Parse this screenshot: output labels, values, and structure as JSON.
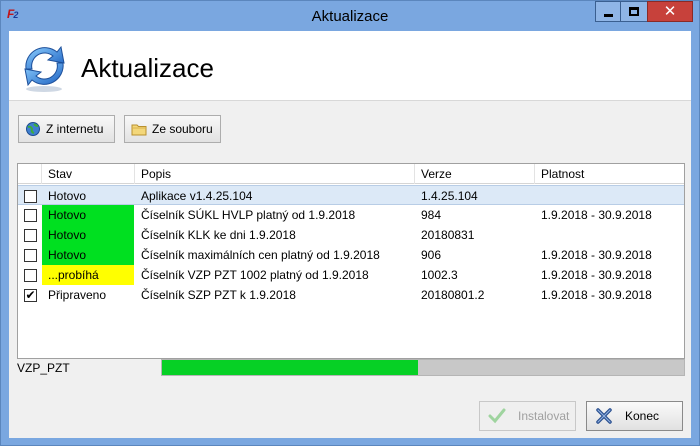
{
  "window": {
    "title": "Aktualizace",
    "app_icon_text": "F",
    "app_icon_sub": "2",
    "icons": {
      "minimize": "minimize-icon",
      "maximize": "maximize-icon",
      "close": "close-icon",
      "close_glyph": "✕"
    }
  },
  "header": {
    "title": "Aktualizace",
    "icon": "refresh-arrows-icon"
  },
  "toolbar": {
    "internet_label": "Z internetu",
    "internet_icon": "globe-icon",
    "soubor_label": "Ze souboru",
    "soubor_icon": "folder-icon"
  },
  "grid": {
    "columns": {
      "stav": "Stav",
      "popis": "Popis",
      "verze": "Verze",
      "platnost": "Platnost"
    },
    "rows": [
      {
        "checked": false,
        "stav": "Hotovo",
        "stav_color": "",
        "popis": "Aplikace v1.4.25.104",
        "verze": "1.4.25.104",
        "platnost": "",
        "selected": true
      },
      {
        "checked": false,
        "stav": "Hotovo",
        "stav_color": "#00e020",
        "popis": "Číselník SÚKL HVLP platný od 1.9.2018",
        "verze": "984",
        "platnost": "1.9.2018 - 30.9.2018",
        "selected": false
      },
      {
        "checked": false,
        "stav": "Hotovo",
        "stav_color": "#00e020",
        "popis": "Číselník KLK ke dni 1.9.2018",
        "verze": "20180831",
        "platnost": "",
        "selected": false
      },
      {
        "checked": false,
        "stav": "Hotovo",
        "stav_color": "#00e020",
        "popis": "Číselník maximálních cen platný od 1.9.2018",
        "verze": "906",
        "platnost": "1.9.2018 - 30.9.2018",
        "selected": false
      },
      {
        "checked": false,
        "stav": "...probíhá",
        "stav_color": "#ffff00",
        "popis": "Číselník VZP PZT 1002 platný od 1.9.2018",
        "verze": "1002.3",
        "platnost": "1.9.2018 - 30.9.2018",
        "selected": false
      },
      {
        "checked": true,
        "stav": "Připraveno",
        "stav_color": "",
        "popis": "Číselník SZP PZT k 1.9.2018",
        "verze": "20180801.2",
        "platnost": "1.9.2018 - 30.9.2018",
        "selected": false
      }
    ],
    "check_glyph": "✔"
  },
  "progress": {
    "label": "VZP_PZT",
    "fraction": 0.49,
    "color": "#06d025"
  },
  "footer": {
    "install_label": "Instalovat",
    "install_icon": "checkmark-icon",
    "install_enabled": false,
    "close_label": "Konec",
    "close_icon": "cross-icon"
  }
}
